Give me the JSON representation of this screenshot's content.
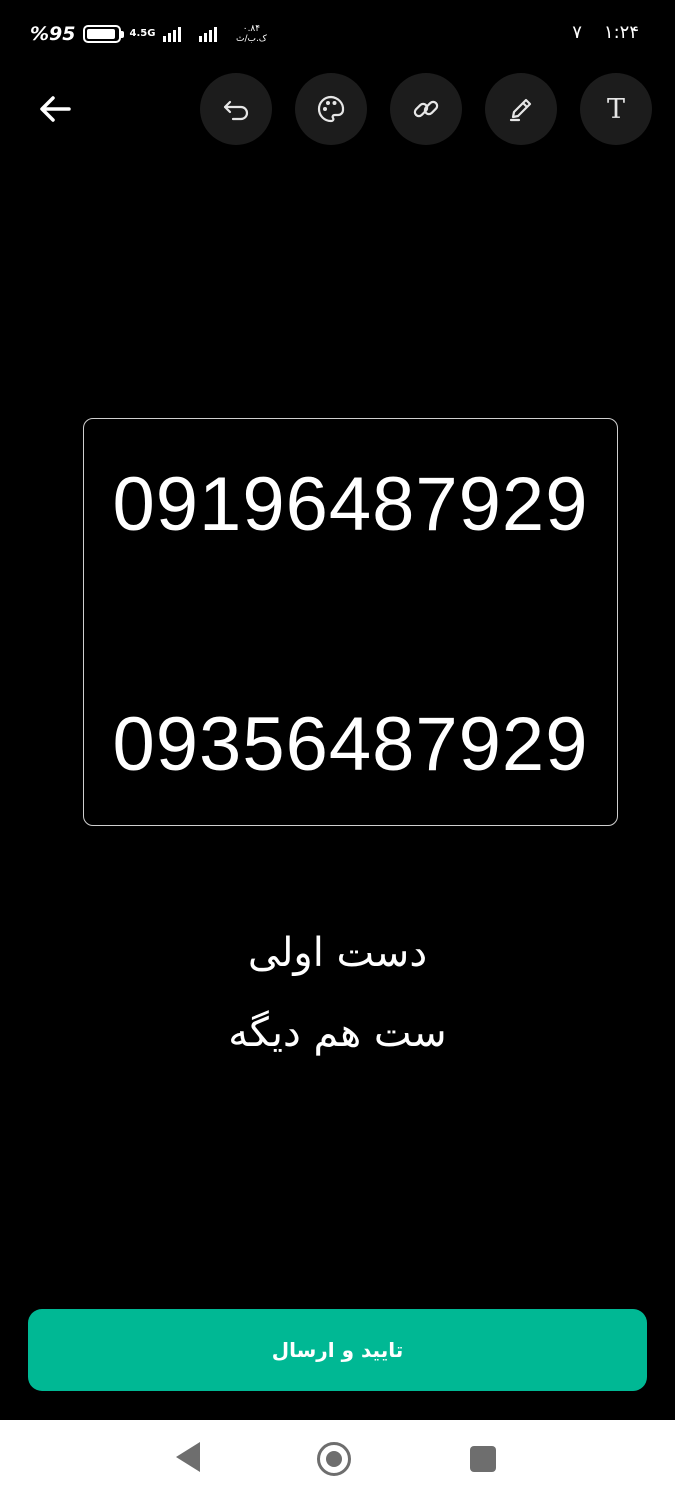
{
  "status_bar": {
    "battery_percent": "%95",
    "network_type": "4.5G",
    "data_speed": "۰.۸۴ ک.ب/ث",
    "notification_count": "۷",
    "time": "۱:۲۴"
  },
  "toolbar": {
    "back_icon": "arrow-left-icon",
    "tools": [
      {
        "icon": "undo-icon"
      },
      {
        "icon": "palette-icon"
      },
      {
        "icon": "link-icon"
      },
      {
        "icon": "pen-icon"
      },
      {
        "icon": "text-icon",
        "glyph": "T"
      }
    ]
  },
  "card": {
    "number_1": "09196487929",
    "number_2": "09356487929"
  },
  "caption": {
    "line_1": "دست اولی",
    "line_2": "ست هم دیگه"
  },
  "submit_button": {
    "label": "تایید و ارسال",
    "color": "#00b894"
  },
  "nav_bar": {
    "back_icon": "nav-back-icon",
    "home_icon": "nav-home-icon",
    "recents_icon": "nav-recents-icon"
  }
}
